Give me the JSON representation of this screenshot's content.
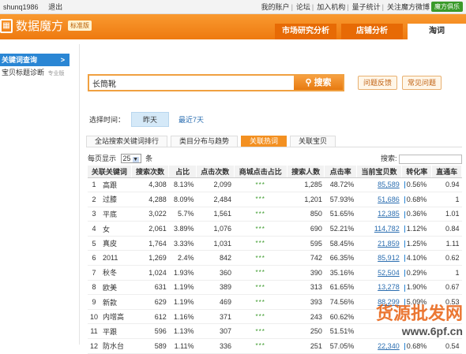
{
  "topbar": {
    "user": "shunq1986",
    "logout": "退出",
    "links": [
      "我的账户",
      "论坛",
      "加入机构",
      "量子统计",
      "关注魔方微博"
    ],
    "badge": "魔方俱乐"
  },
  "header": {
    "logo": "数据魔方",
    "edition": "标准版",
    "tabs": [
      "市场研究分析",
      "店铺分析",
      "淘词"
    ]
  },
  "sidebar": {
    "items": [
      {
        "label": "关键词查询",
        "tag": ""
      },
      {
        "label": "宝贝标题诊断",
        "tag": "专业版"
      }
    ]
  },
  "search": {
    "value": "长筒靴",
    "button": "搜索",
    "feedback": "问题反馈",
    "faq": "常见问题"
  },
  "time": {
    "label": "选择时间：",
    "selected": "昨天",
    "link": "最近7天"
  },
  "subtabs": [
    "全站搜索关键词排行",
    "类目分布与趋势",
    "关联热词",
    "关联宝贝"
  ],
  "controls": {
    "per_page_prefix": "每页显示",
    "per_page_value": "25",
    "per_page_suffix": "条",
    "filter_label": "搜索:"
  },
  "table": {
    "headers": [
      "关联关键词",
      "搜索次数",
      "占比",
      "点击次数",
      "商城点击占比",
      "搜索人数",
      "点击率",
      "当前宝贝数",
      "转化率",
      "直通车"
    ],
    "rows": [
      [
        "1",
        "高跟",
        "4,308",
        "8.13%",
        "2,099",
        "***",
        "1,285",
        "48.72%",
        "85,589",
        "0.56%",
        "0.94"
      ],
      [
        "2",
        "过膝",
        "4,288",
        "8.09%",
        "2,484",
        "***",
        "1,201",
        "57.93%",
        "51,686",
        "0.68%",
        "1"
      ],
      [
        "3",
        "平底",
        "3,022",
        "5.7%",
        "1,561",
        "***",
        "850",
        "51.65%",
        "12,385",
        "0.36%",
        "1.01"
      ],
      [
        "4",
        "女",
        "2,061",
        "3.89%",
        "1,076",
        "***",
        "690",
        "52.21%",
        "114,782",
        "1.12%",
        "0.84"
      ],
      [
        "5",
        "真皮",
        "1,764",
        "3.33%",
        "1,031",
        "***",
        "595",
        "58.45%",
        "21,859",
        "1.25%",
        "1.11"
      ],
      [
        "6",
        "2011",
        "1,269",
        "2.4%",
        "842",
        "***",
        "742",
        "66.35%",
        "85,912",
        "4.10%",
        "0.62"
      ],
      [
        "7",
        "秋冬",
        "1,024",
        "1.93%",
        "360",
        "***",
        "390",
        "35.16%",
        "52,504",
        "0.29%",
        "1"
      ],
      [
        "8",
        "欧美",
        "631",
        "1.19%",
        "389",
        "***",
        "313",
        "61.65%",
        "13,278",
        "1.90%",
        "0.67"
      ],
      [
        "9",
        "新款",
        "629",
        "1.19%",
        "469",
        "***",
        "393",
        "74.56%",
        "88,299",
        "5.09%",
        "0.53"
      ],
      [
        "10",
        "内增高",
        "612",
        "1.16%",
        "371",
        "***",
        "243",
        "60.62%",
        "",
        "",
        ""
      ],
      [
        "11",
        "平跟",
        "596",
        "1.13%",
        "307",
        "***",
        "250",
        "51.51%",
        "",
        "",
        ""
      ],
      [
        "12",
        "防水台",
        "589",
        "1.11%",
        "336",
        "***",
        "251",
        "57.05%",
        "22,340",
        "0.68%",
        "0.54"
      ]
    ]
  },
  "watermark": {
    "main": "货源批发网",
    "sub": "www.6pf.cn"
  },
  "colors": {
    "brand": "#ee7a10",
    "link": "#2a6db0",
    "sidebar_active": "#2a86d4"
  }
}
